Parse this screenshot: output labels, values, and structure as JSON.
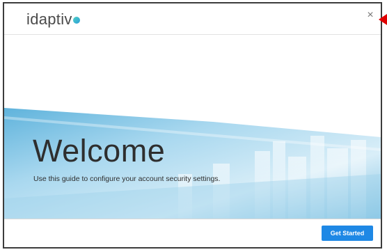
{
  "header": {
    "logo_text": "idaptiv",
    "close_glyph": "×"
  },
  "main": {
    "title": "Welcome",
    "subtitle": "Use this guide to configure your account security settings."
  },
  "footer": {
    "get_started_label": "Get Started"
  },
  "icons": {
    "close": "close-icon",
    "logo_mark": "logo-dot-icon",
    "annotation": "red-arrow-icon"
  },
  "colors": {
    "accent": "#1e88e5",
    "banner_light": "#d6ecf7",
    "banner_mid": "#8fc9e6",
    "annotation_arrow": "#e00000"
  }
}
